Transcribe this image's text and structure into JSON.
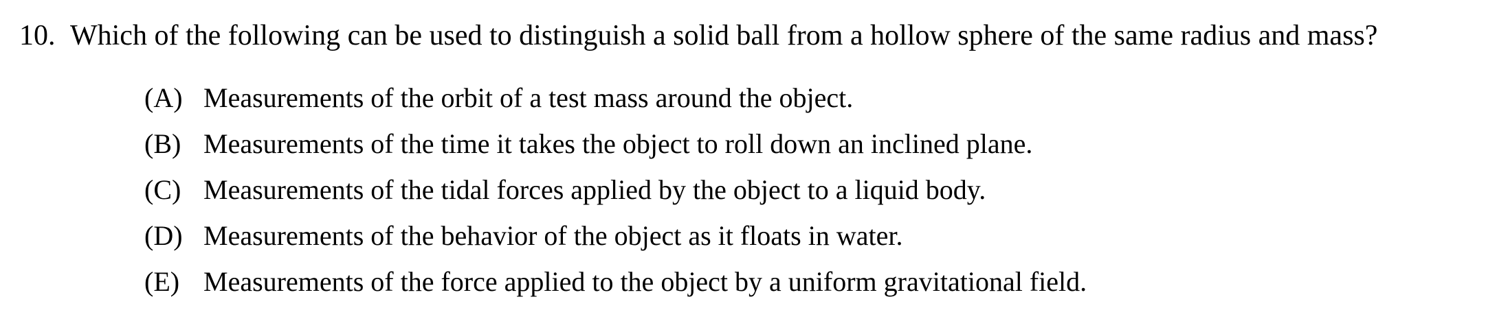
{
  "question": {
    "number": "10.",
    "text": "Which of the following can be used to distinguish a solid ball from a hollow sphere of the same radius and mass?",
    "choices": [
      {
        "letter": "(A)",
        "text": "Measurements of the orbit of a test mass around the object."
      },
      {
        "letter": "(B)",
        "text": "Measurements of the time it takes the object to roll down an inclined plane."
      },
      {
        "letter": "(C)",
        "text": "Measurements of the tidal forces applied by the object to a liquid body."
      },
      {
        "letter": "(D)",
        "text": "Measurements of the behavior of the object as it floats in water."
      },
      {
        "letter": "(E)",
        "text": "Measurements of the force applied to the object by a uniform gravitational field."
      }
    ]
  }
}
